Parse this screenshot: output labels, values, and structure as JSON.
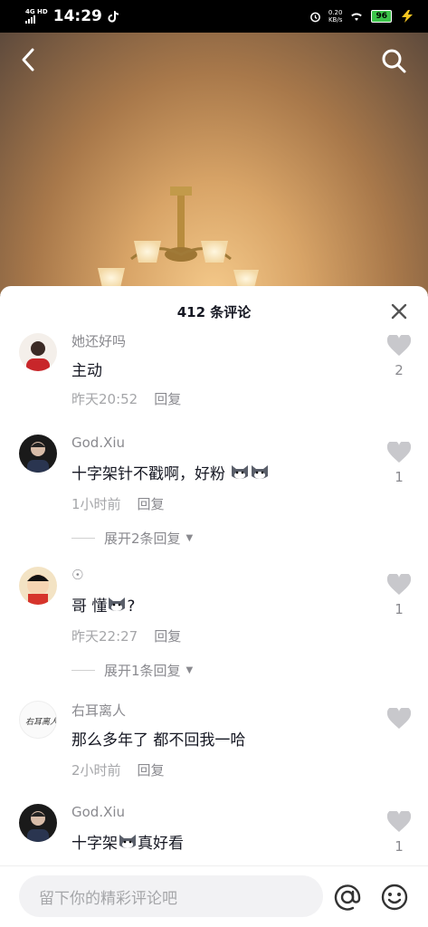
{
  "status_bar": {
    "time": "14:29",
    "network": "4G HD",
    "net_speed_value": "0.20",
    "net_speed_unit": "KB/s",
    "battery": "96"
  },
  "header": {
    "back_icon": "chevron-left-icon",
    "search_icon": "search-icon"
  },
  "comments_panel": {
    "title": "412 条评论",
    "reply_label": "回复",
    "comments": [
      {
        "user": "她还好吗",
        "text": "主动",
        "time": "昨天20:52",
        "likes": "2"
      },
      {
        "user": "God.Xiu",
        "text": "十字架针不戳啊，好粉",
        "time": "1小时前",
        "likes": "1",
        "expand": "展开2条回复"
      },
      {
        "user": "☉",
        "text_a": "哥 懂",
        "text_b": "?",
        "time": "昨天22:27",
        "likes": "1",
        "expand": "展开1条回复"
      },
      {
        "user": "右耳离人",
        "text": "那么多年了 都不回我一哈",
        "time": "2小时前",
        "likes": ""
      },
      {
        "user": "God.Xiu",
        "text_a": "十字架",
        "text_b": "真好看",
        "time": "",
        "likes": "1"
      }
    ]
  },
  "bottom_bar": {
    "input_placeholder": "留下你的精彩评论吧",
    "at_icon": "at-icon",
    "emoji_icon": "emoji-icon"
  },
  "colors": {
    "accent_text": "#161823",
    "secondary_text": "#8a8a8f",
    "like_icon": "#c8c8cc"
  }
}
